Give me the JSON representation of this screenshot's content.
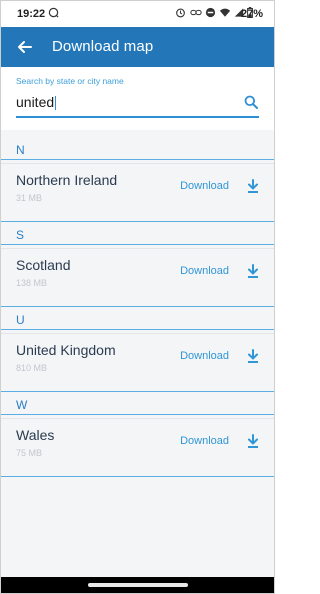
{
  "status_bar": {
    "time": "19:22",
    "battery": "27%"
  },
  "app_bar": {
    "title": "Download map"
  },
  "search": {
    "label": "Search by state or city name",
    "value": "united"
  },
  "list": {
    "sections": [
      {
        "letter": "N",
        "items": [
          {
            "name": "Northern Ireland",
            "size": "31 MB",
            "action": "Download"
          }
        ]
      },
      {
        "letter": "S",
        "items": [
          {
            "name": "Scotland",
            "size": "138 MB",
            "action": "Download"
          }
        ]
      },
      {
        "letter": "U",
        "items": [
          {
            "name": "United Kingdom",
            "size": "810 MB",
            "action": "Download"
          }
        ]
      },
      {
        "letter": "W",
        "items": [
          {
            "name": "Wales",
            "size": "75 MB",
            "action": "Download"
          }
        ]
      }
    ]
  },
  "colors": {
    "app_bar": "#2377b9",
    "accent": "#3096d6",
    "background": "#f4f5f7"
  }
}
